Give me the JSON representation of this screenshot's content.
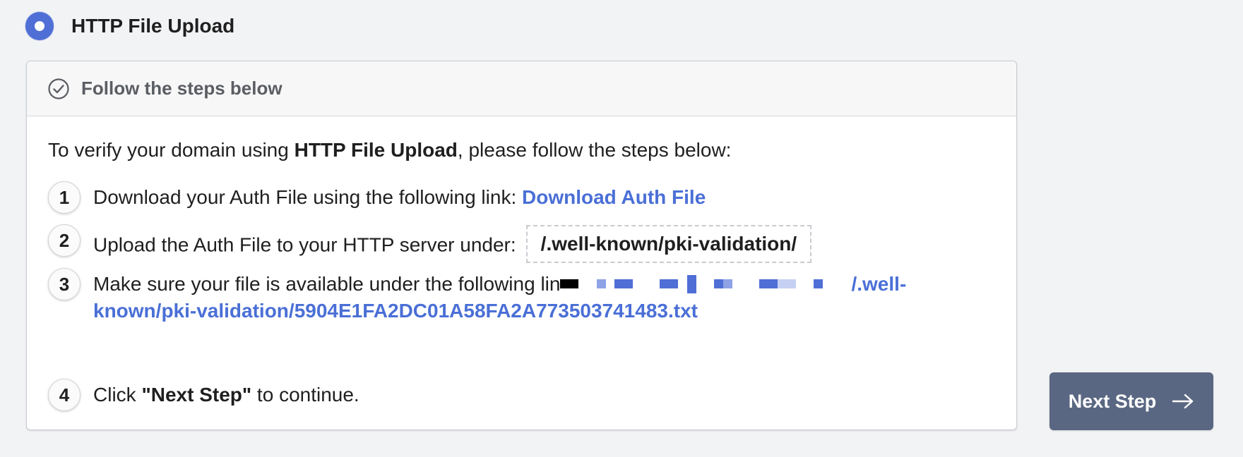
{
  "option": {
    "label": "HTTP File Upload",
    "selected": true
  },
  "card": {
    "header_title": "Follow the steps below",
    "intro_prefix": "To verify your domain using ",
    "intro_bold": "HTTP File Upload",
    "intro_suffix": ", please follow the steps below:",
    "steps": [
      {
        "number": "1",
        "text": "Download your Auth File using the following link: ",
        "link_label": "Download Auth File"
      },
      {
        "number": "2",
        "text": "Upload the Auth File to your HTTP server under:",
        "path": "/.well-known/pki-validation/"
      },
      {
        "number": "3",
        "text": "Make sure your file is available under the following lin",
        "link_tail": "/.well-known/pki-validation/5904E1FA2DC01A58FA2A773503741483.txt"
      },
      {
        "number": "4",
        "text_prefix": "Click ",
        "text_bold": "\"Next Step\"",
        "text_suffix": " to continue."
      }
    ]
  },
  "next_button": {
    "label": "Next Step"
  },
  "colors": {
    "accent": "#4f6fd6",
    "link": "#4a6fd6",
    "button_bg": "#5a6782",
    "page_bg": "#f2f3f5"
  },
  "icons": {
    "radio": "radio-selected-icon",
    "header": "check-circle-icon",
    "button": "arrow-right-icon"
  }
}
